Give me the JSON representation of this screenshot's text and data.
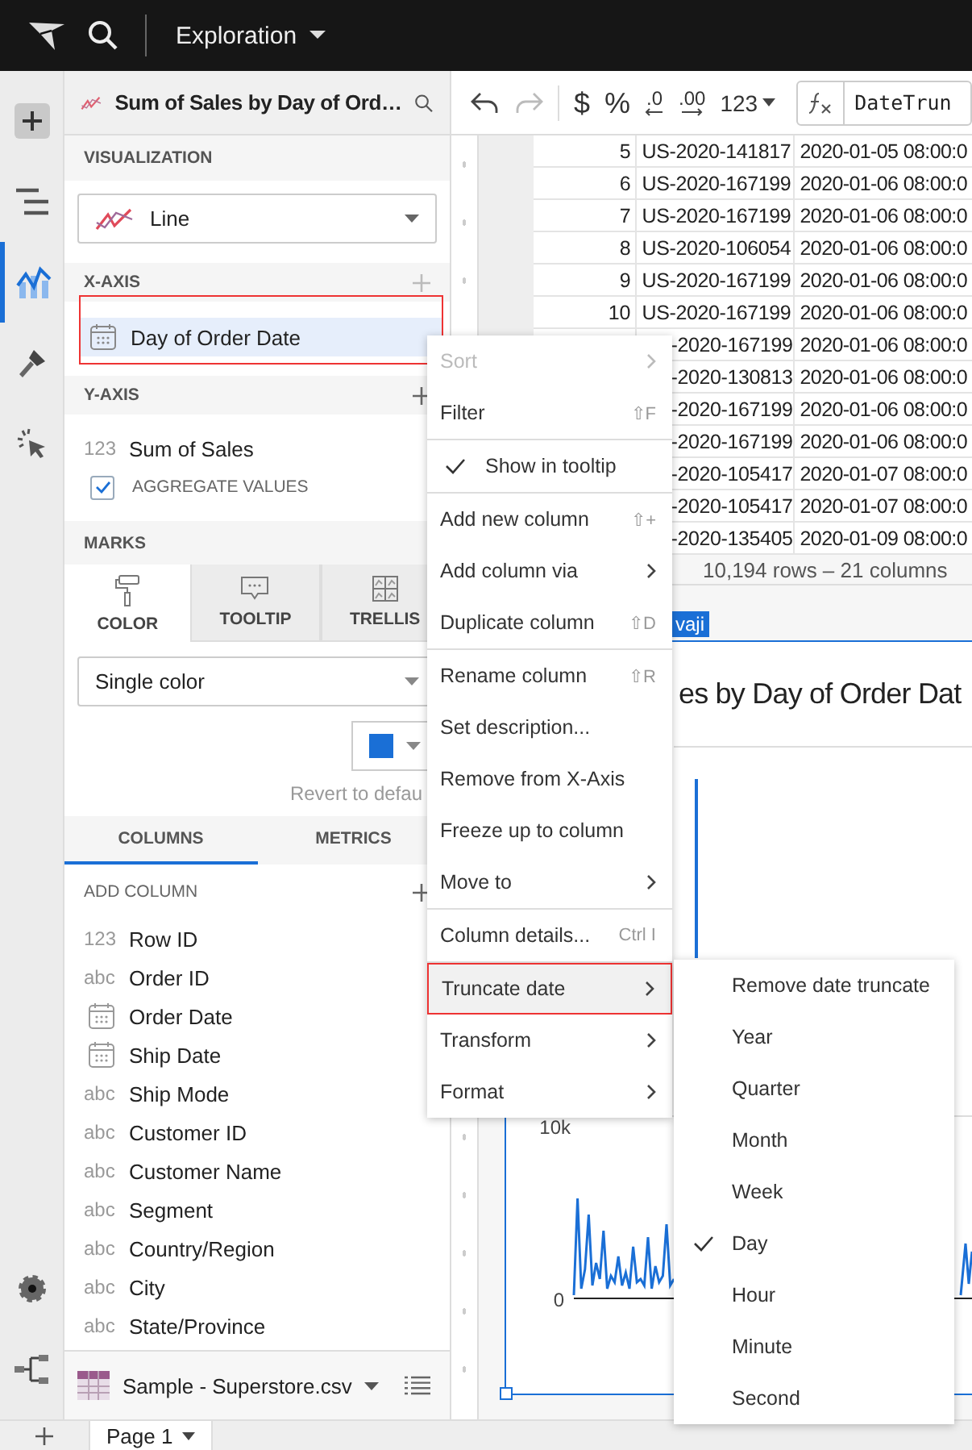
{
  "topbar": {
    "title": "Exploration"
  },
  "rail": [
    {
      "kind": "plus",
      "selected": false
    },
    {
      "kind": "outline",
      "selected": false
    },
    {
      "kind": "chart",
      "selected": true
    },
    {
      "kind": "brush",
      "selected": false
    },
    {
      "kind": "pointer",
      "selected": false
    }
  ],
  "rail_bottom": [
    {
      "kind": "gear"
    },
    {
      "kind": "tree"
    }
  ],
  "panel": {
    "title": "Sum of Sales by Day of Ord…",
    "visualization": {
      "label": "VISUALIZATION",
      "value": "Line"
    },
    "x_axis": {
      "label": "X-AXIS",
      "field": "Day of Order Date"
    },
    "y_axis": {
      "label": "Y-AXIS",
      "type": "123",
      "field": "Sum of Sales",
      "aggregate_label": "AGGREGATE VALUES",
      "aggregate_checked": true
    },
    "marks": {
      "label": "MARKS",
      "tabs": [
        {
          "kind": "color",
          "label": "COLOR",
          "selected": true
        },
        {
          "kind": "tooltip",
          "label": "TOOLTIP",
          "selected": false
        },
        {
          "kind": "trellis",
          "label": "TRELLIS",
          "selected": false
        }
      ],
      "color_mode": "Single color",
      "revert": "Revert to defau"
    },
    "list_tabs": [
      {
        "label": "COLUMNS",
        "selected": true
      },
      {
        "label": "METRICS",
        "selected": false
      }
    ],
    "add_column": "ADD COLUMN",
    "columns": [
      {
        "kind": "typed",
        "type": "123",
        "name": "Row ID"
      },
      {
        "kind": "typed",
        "type": "abc",
        "name": "Order ID"
      },
      {
        "kind": "date",
        "name": "Order Date"
      },
      {
        "kind": "date",
        "name": "Ship Date"
      },
      {
        "kind": "typed",
        "type": "abc",
        "name": "Ship Mode"
      },
      {
        "kind": "typed",
        "type": "abc",
        "name": "Customer ID"
      },
      {
        "kind": "typed",
        "type": "abc",
        "name": "Customer Name"
      },
      {
        "kind": "typed",
        "type": "abc",
        "name": "Segment"
      },
      {
        "kind": "typed",
        "type": "abc",
        "name": "Country/Region"
      },
      {
        "kind": "typed",
        "type": "abc",
        "name": "City"
      },
      {
        "kind": "typed",
        "type": "abc",
        "name": "State/Province"
      }
    ],
    "source": "Sample - Superstore.csv"
  },
  "toolbar": {
    "currency": "$",
    "percent": "%",
    "decimals": [
      ".0",
      ".00"
    ],
    "number_format": "123",
    "formula": "DateTrun"
  },
  "table": {
    "rows": [
      {
        "number": "5",
        "order_id": "US-2020-141817",
        "date": "2020-01-05 08:00:0"
      },
      {
        "number": "6",
        "order_id": "US-2020-167199",
        "date": "2020-01-06 08:00:0"
      },
      {
        "number": "7",
        "order_id": "US-2020-167199",
        "date": "2020-01-06 08:00:0"
      },
      {
        "number": "8",
        "order_id": "US-2020-106054",
        "date": "2020-01-06 08:00:0"
      },
      {
        "number": "9",
        "order_id": "US-2020-167199",
        "date": "2020-01-06 08:00:0"
      },
      {
        "number": "10",
        "order_id": "US-2020-167199",
        "date": "2020-01-06 08:00:0"
      },
      {
        "order_id": "-2020-167199",
        "date": "2020-01-06 08:00:0"
      },
      {
        "order_id": "-2020-130813",
        "date": "2020-01-06 08:00:0"
      },
      {
        "order_id": "-2020-167199",
        "date": "2020-01-06 08:00:0"
      },
      {
        "order_id": "-2020-167199",
        "date": "2020-01-06 08:00:0"
      },
      {
        "order_id": "-2020-105417",
        "date": "2020-01-07 08:00:0"
      },
      {
        "order_id": "-2020-105417",
        "date": "2020-01-07 08:00:0"
      },
      {
        "order_id": "-2020-135405",
        "date": "2020-01-09 08:00:0"
      }
    ],
    "footer": "10,194 rows – 21 columns"
  },
  "chart": {
    "tag": "vaji",
    "title": "es by Day of Order Dat",
    "y_labels": [
      "10k",
      "0"
    ]
  },
  "context_menu": [
    {
      "kind": "submenu",
      "label": "Sort",
      "disabled": true,
      "selected": false
    },
    {
      "kind": "item",
      "label": "Filter",
      "shortcut": "⇧F",
      "disabled": false,
      "selected": false
    },
    {
      "kind": "separator"
    },
    {
      "kind": "check",
      "label": "Show in tooltip",
      "checked": true,
      "disabled": false,
      "selected": false
    },
    {
      "kind": "separator"
    },
    {
      "kind": "item",
      "label": "Add new column",
      "shortcut": "⇧+",
      "disabled": false,
      "selected": false
    },
    {
      "kind": "submenu",
      "label": "Add column via",
      "disabled": false,
      "selected": false
    },
    {
      "kind": "item",
      "label": "Duplicate column",
      "shortcut": "⇧D",
      "disabled": false,
      "selected": false
    },
    {
      "kind": "separator"
    },
    {
      "kind": "item",
      "label": "Rename column",
      "shortcut": "⇧R",
      "disabled": false,
      "selected": false
    },
    {
      "kind": "item",
      "label": "Set description...",
      "disabled": false,
      "selected": false
    },
    {
      "kind": "item",
      "label": "Remove from X-Axis",
      "disabled": false,
      "selected": false
    },
    {
      "kind": "item",
      "label": "Freeze up to column",
      "disabled": false,
      "selected": false
    },
    {
      "kind": "submenu",
      "label": "Move to",
      "disabled": false,
      "selected": false
    },
    {
      "kind": "separator"
    },
    {
      "kind": "item",
      "label": "Column details...",
      "shortcut": "Ctrl I",
      "disabled": false,
      "selected": false
    },
    {
      "kind": "separator"
    },
    {
      "kind": "submenu",
      "label": "Truncate date",
      "disabled": false,
      "selected": true
    },
    {
      "kind": "submenu",
      "label": "Transform",
      "disabled": false,
      "selected": false
    },
    {
      "kind": "submenu",
      "label": "Format",
      "disabled": false,
      "selected": false
    }
  ],
  "submenu": [
    {
      "label": "Remove date truncate",
      "checked": false
    },
    {
      "label": "Year",
      "checked": false
    },
    {
      "label": "Quarter",
      "checked": false
    },
    {
      "label": "Month",
      "checked": false
    },
    {
      "label": "Week",
      "checked": false
    },
    {
      "label": "Day",
      "checked": true
    },
    {
      "label": "Hour",
      "checked": false
    },
    {
      "label": "Minute",
      "checked": false
    },
    {
      "label": "Second",
      "checked": false
    }
  ],
  "pages": [
    {
      "label": "Page 1",
      "selected": true
    }
  ]
}
